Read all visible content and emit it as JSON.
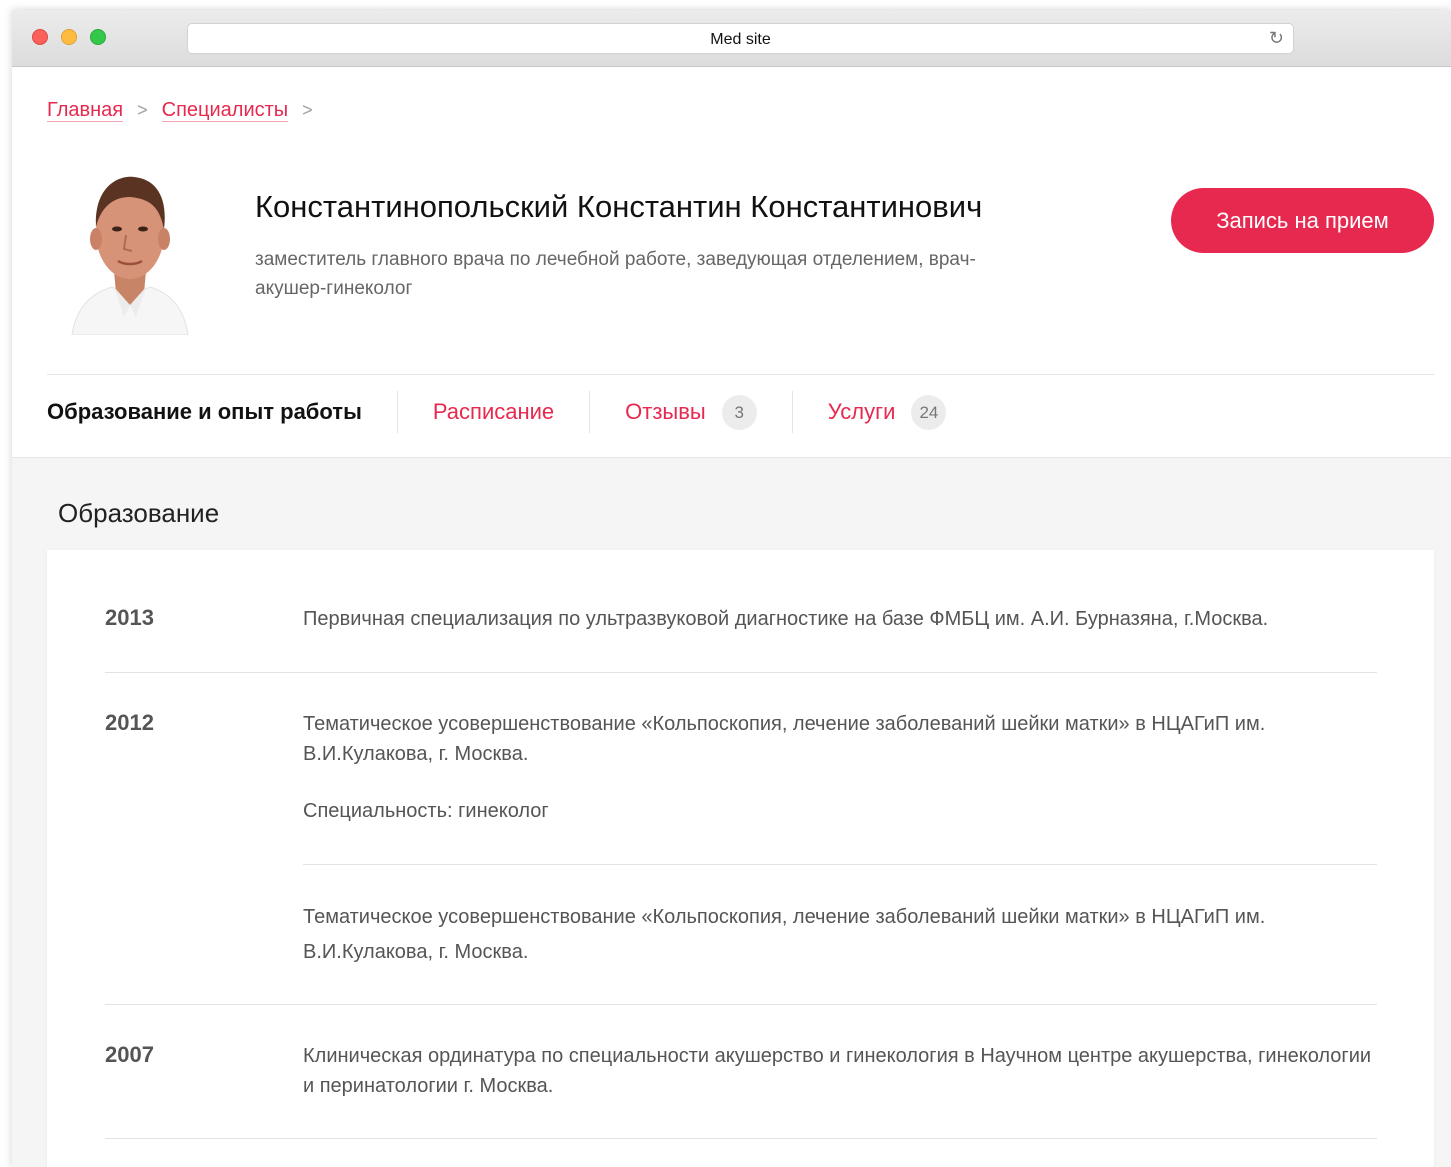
{
  "browser": {
    "url_title": "Med site"
  },
  "breadcrumb": {
    "items": [
      "Главная",
      "Специалисты"
    ],
    "separator": ">"
  },
  "doctor": {
    "name": "Константинопольский Константин Константинович",
    "position": "заместитель главного врача по лечебной работе, заведующая отделением, врач-акушер-гинеколог"
  },
  "appointment_button": "Запись на прием",
  "tabs": [
    {
      "label": "Образование и опыт работы"
    },
    {
      "label": "Расписание"
    },
    {
      "label": "Отзывы",
      "count": "3"
    },
    {
      "label": "Услуги",
      "count": "24"
    }
  ],
  "education": {
    "title": "Образование",
    "entries": [
      {
        "year": "2013",
        "text": "Первичная специализация по ультразвуковой диагностике на базе ФМБЦ им. А.И. Бурназяна, г.Москва."
      },
      {
        "year": "2012",
        "text": "Тематическое усовершенствование «Кольпоскопия, лечение заболеваний шейки матки» в НЦАГиП им. В.И.Кулакова, г. Москва.",
        "specialty": "Специальность: гинеколог"
      },
      {
        "year": "",
        "text": "Тематическое усовершенствование «Кольпоскопия, лечение заболеваний шейки матки» в НЦАГиП им. В.И.Кулакова, г. Москва."
      },
      {
        "year": "2007",
        "text": "Клиническая ординатура по специальности акушерство и гинекология в Научном центре акушерства, гинекологии и перинатологии г. Москва."
      }
    ]
  },
  "colors": {
    "accent": "#e8294f",
    "content_bg": "#f5f5f5"
  },
  "icons": [
    "reload-icon",
    "chevron-right-icon"
  ]
}
